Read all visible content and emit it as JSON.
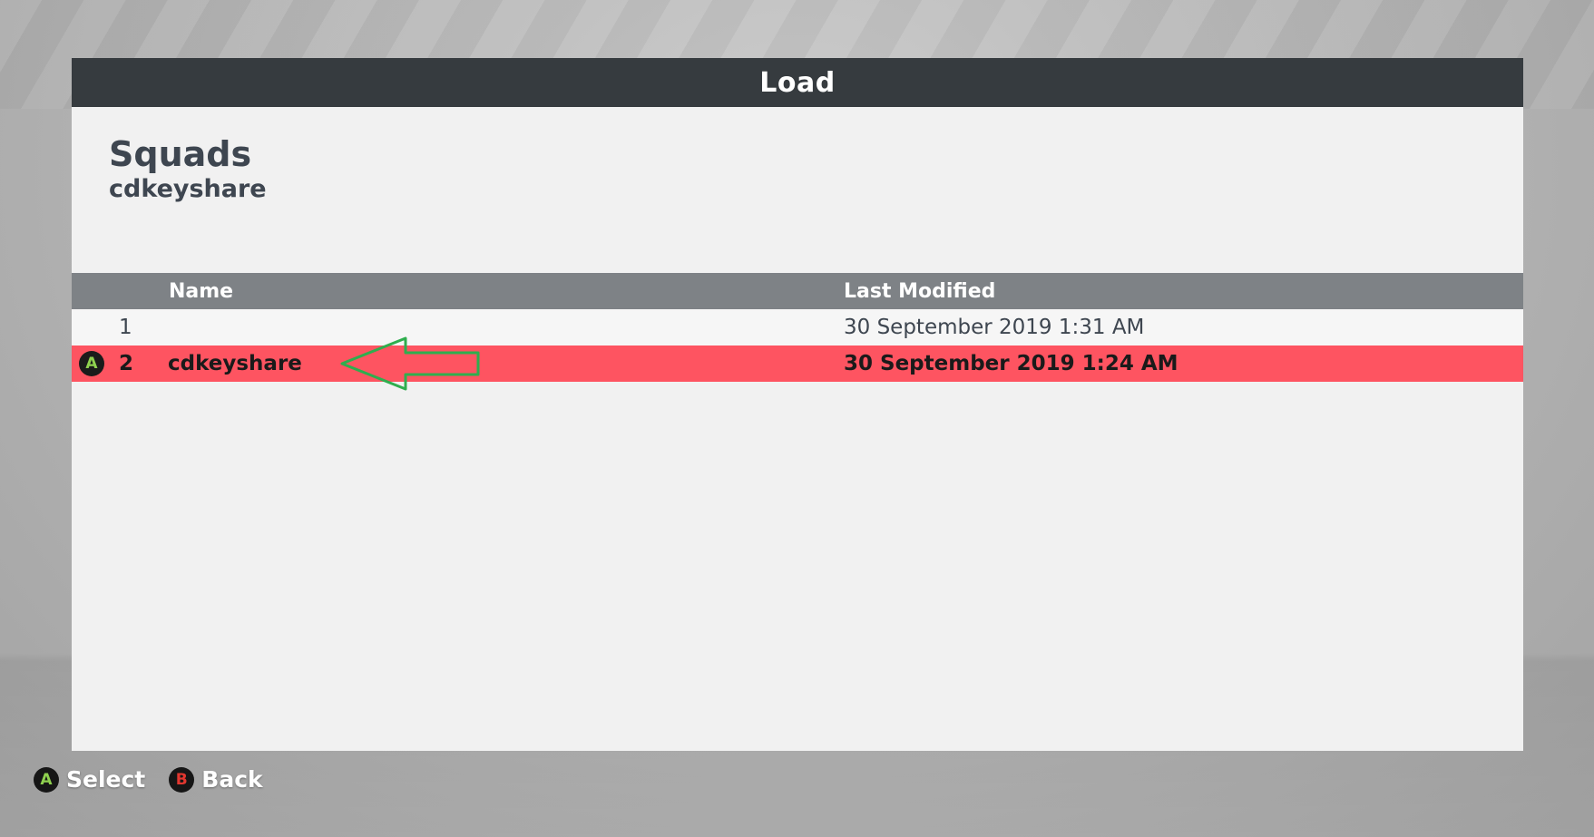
{
  "dialog": {
    "title": "Load"
  },
  "section": {
    "title": "Squads",
    "subtitle": "cdkeyshare"
  },
  "table": {
    "columns": {
      "name": "Name",
      "last_modified": "Last Modified"
    },
    "rows": [
      {
        "number": "1",
        "name": "",
        "last_modified": "30 September 2019 1:31 AM",
        "selected": false
      },
      {
        "number": "2",
        "name": "cdkeyshare",
        "last_modified": "30 September 2019 1:24 AM",
        "selected": true
      }
    ]
  },
  "selected_row_button_glyph": "A",
  "footer": {
    "select": {
      "glyph": "A",
      "label": "Select"
    },
    "back": {
      "glyph": "B",
      "label": "Back"
    }
  },
  "colors": {
    "header_bg": "#363b3f",
    "selected_row": "#fe5461",
    "a_button": "#8fd14f",
    "b_button": "#e2372f",
    "annotation_arrow": "#2fae4e"
  },
  "annotation": {
    "icon": "left-arrow-icon"
  }
}
